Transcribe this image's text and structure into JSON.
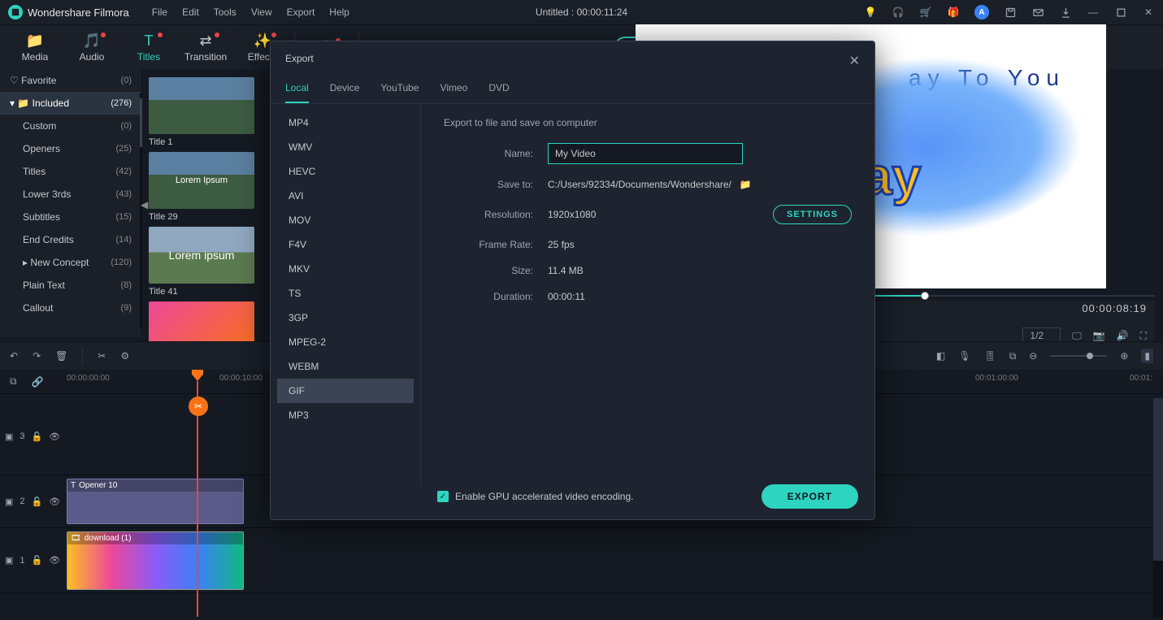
{
  "app": {
    "name": "Wondershare Filmora",
    "title": "Untitled :  00:00:11:24"
  },
  "menu": [
    "File",
    "Edit",
    "Tools",
    "View",
    "Export",
    "Help"
  ],
  "tabs": [
    {
      "label": "Media"
    },
    {
      "label": "Audio"
    },
    {
      "label": "Titles"
    },
    {
      "label": "Transition"
    },
    {
      "label": "Effects"
    }
  ],
  "sidebar": {
    "favorite": {
      "label": "Favorite",
      "count": "(0)"
    },
    "included": {
      "label": "Included",
      "count": "(276)"
    },
    "items": [
      {
        "label": "Custom",
        "count": "(0)"
      },
      {
        "label": "Openers",
        "count": "(25)"
      },
      {
        "label": "Titles",
        "count": "(42)"
      },
      {
        "label": "Lower 3rds",
        "count": "(43)"
      },
      {
        "label": "Subtitles",
        "count": "(15)"
      },
      {
        "label": "End Credits",
        "count": "(14)"
      },
      {
        "label": "New Concept",
        "count": "(120)"
      },
      {
        "label": "Plain Text",
        "count": "(8)"
      },
      {
        "label": "Callout",
        "count": "(9)"
      }
    ]
  },
  "gallery": [
    {
      "label": "Title 1"
    },
    {
      "label": "Title 29",
      "ph": "Lorem Ipsum"
    },
    {
      "label": "Title 41",
      "ph": "Lorem ipsum"
    },
    {
      "label": ""
    }
  ],
  "preview": {
    "line1": "ay To You",
    "line2": "ay"
  },
  "player": {
    "timecode": "00:00:08:19",
    "zoom": "1/2"
  },
  "ruler": {
    "t0": "00:00:00:00",
    "t1": "00:00:10:00",
    "t2": "00:01:00:00",
    "t3": "00:01:"
  },
  "tracks": {
    "t3": "3",
    "t2": "2",
    "t1": "1",
    "clip2": "Opener 10",
    "clip1": "download (1)"
  },
  "export": {
    "title": "Export",
    "tabs": [
      "Local",
      "Device",
      "YouTube",
      "Vimeo",
      "DVD"
    ],
    "formats": [
      "MP4",
      "WMV",
      "HEVC",
      "AVI",
      "MOV",
      "F4V",
      "MKV",
      "TS",
      "3GP",
      "MPEG-2",
      "WEBM",
      "GIF",
      "MP3"
    ],
    "selected": "GIF",
    "desc": "Export to file and save on computer",
    "name_label": "Name:",
    "name_value": "My Video",
    "save_label": "Save to:",
    "save_value": "C:/Users/92334/Documents/Wondershare/",
    "res_label": "Resolution:",
    "res_value": "1920x1080",
    "fps_label": "Frame Rate:",
    "fps_value": "25 fps",
    "size_label": "Size:",
    "size_value": "11.4 MB",
    "dur_label": "Duration:",
    "dur_value": "00:00:11",
    "settings": "SETTINGS",
    "gpu": "Enable GPU accelerated video encoding.",
    "export_btn": "EXPORT"
  }
}
